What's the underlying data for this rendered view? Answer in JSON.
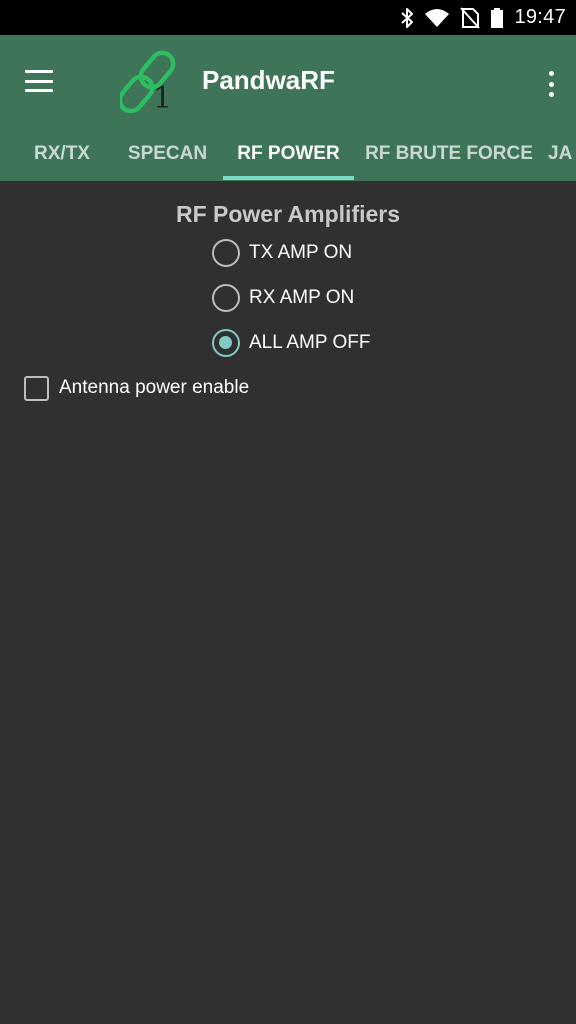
{
  "status_bar": {
    "time": "19:47",
    "icons": [
      "bluetooth-icon",
      "wifi-icon",
      "no-sim-icon",
      "battery-icon"
    ]
  },
  "app_bar": {
    "title": "PandwaRF",
    "logo_text": "1",
    "colors": {
      "background": "#3e7558",
      "accent": "#7bdcc8"
    }
  },
  "tabs": [
    {
      "label": "RX/TX",
      "active": false
    },
    {
      "label": "SPECAN",
      "active": false
    },
    {
      "label": "RF POWER",
      "active": true
    },
    {
      "label": "RF BRUTE FORCE",
      "active": false
    },
    {
      "label": "JA",
      "active": false
    }
  ],
  "main": {
    "section_title": "RF Power Amplifiers",
    "radio_options": [
      {
        "label": "TX AMP ON",
        "checked": false
      },
      {
        "label": "RX AMP ON",
        "checked": false
      },
      {
        "label": "ALL AMP OFF",
        "checked": true
      }
    ],
    "antenna_checkbox": {
      "label": "Antenna power enable",
      "checked": false
    }
  }
}
